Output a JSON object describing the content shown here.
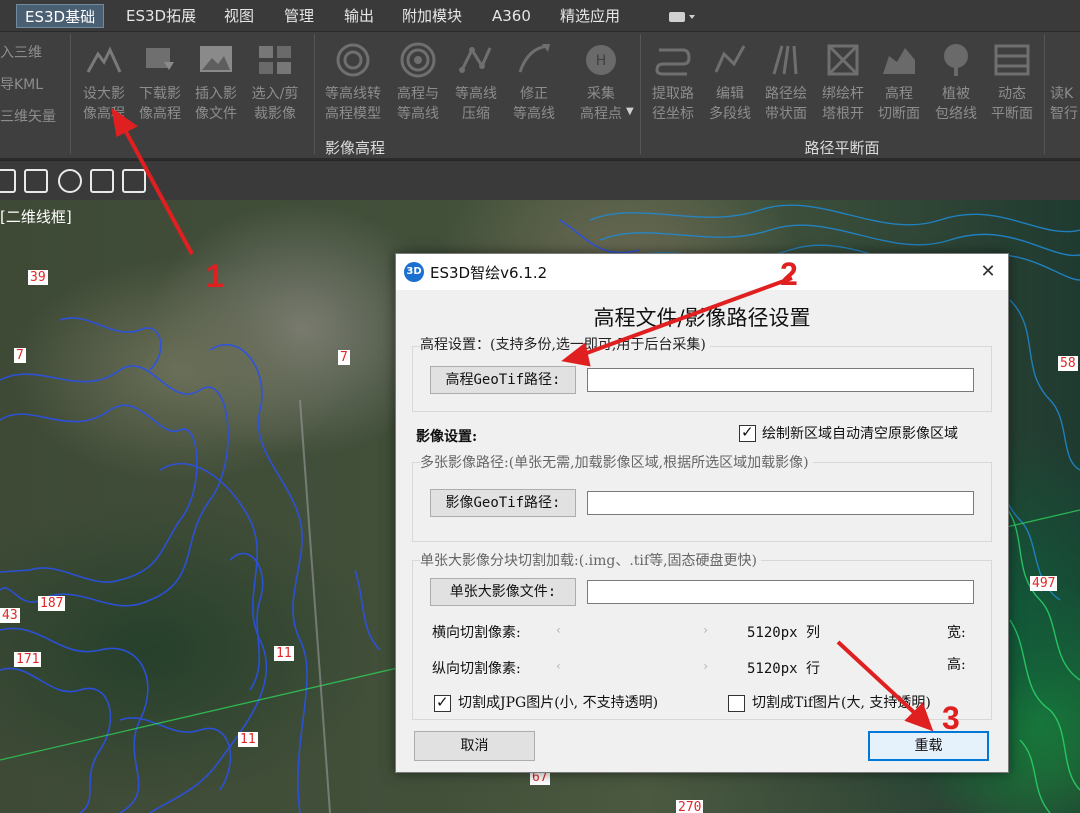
{
  "menubar": {
    "tabs": [
      {
        "label": "ES3D基础",
        "active": true
      },
      {
        "label": "ES3D拓展"
      },
      {
        "label": "视图"
      },
      {
        "label": "管理"
      },
      {
        "label": "输出"
      },
      {
        "label": "附加模块"
      },
      {
        "label": "A360"
      },
      {
        "label": "精选应用"
      }
    ]
  },
  "ribbon": {
    "left_items": [
      "入三维",
      "导KML",
      "三维矢量"
    ],
    "group1_buttons": [
      {
        "line1": "设大影",
        "line2": "像高程"
      },
      {
        "line1": "下载影",
        "line2": "像高程"
      },
      {
        "line1": "插入影",
        "line2": "像文件"
      },
      {
        "line1": "选入/剪",
        "line2": "裁影像"
      }
    ],
    "group2_buttons": [
      {
        "line1": "等高线转",
        "line2": "高程模型"
      },
      {
        "line1": "高程与",
        "line2": "等高线"
      },
      {
        "line1": "等高线",
        "line2": "压缩"
      },
      {
        "line1": "修正",
        "line2": "等高线"
      },
      {
        "line1": "采集",
        "line2": "高程点"
      }
    ],
    "group3_buttons": [
      {
        "line1": "提取路",
        "line2": "径坐标"
      },
      {
        "line1": "编辑",
        "line2": "多段线"
      },
      {
        "line1": "路径绘",
        "line2": "带状面"
      },
      {
        "line1": "绑绘杆",
        "line2": "塔根开"
      },
      {
        "line1": "高程",
        "line2": "切断面"
      },
      {
        "line1": "植被",
        "line2": "包络线"
      },
      {
        "line1": "动态",
        "line2": "平断面"
      }
    ],
    "right_cut": {
      "line1": "读K",
      "line2": "智行"
    },
    "panel_titles": {
      "imagery": "影像高程",
      "route": "路径平断面"
    }
  },
  "viewport": {
    "label": "[二维线框]",
    "elevation_labels": [
      "39",
      "7",
      "7",
      "58",
      "43",
      "187",
      "171",
      "11",
      "11",
      "497",
      "67",
      "270"
    ]
  },
  "dialog": {
    "title": "ES3D智绘v6.1.2",
    "heading": "高程文件/影像路径设置",
    "elev_section": "高程设置：(支持多份,选一即可,用于后台采集)",
    "elev_button": "高程GeoTif路径:",
    "elev_path": "",
    "image_section": "影像设置:",
    "auto_clear_label": "绘制新区域自动清空原影像区域",
    "auto_clear_checked": true,
    "multi_section": "多张影像路径:(单张无需,加载影像区域,根据所选区域加载影像)",
    "image_button": "影像GeoTif路径:",
    "image_path": "",
    "single_section": "单张大影像分块切割加载:(.img、.tif等,固态硬盘更快)",
    "single_button": "单张大影像文件:",
    "single_path": "",
    "h_split_label": "横向切割像素:",
    "h_split_value": "5120px 列",
    "width_label": "宽:",
    "v_split_label": "纵向切割像素:",
    "v_split_value": "5120px 行",
    "height_label": "高:",
    "jpg_label": "切割成JPG图片(小, 不支持透明)",
    "jpg_checked": true,
    "tif_label": "切割成Tif图片(大, 支持透明)",
    "tif_checked": false,
    "cancel_label": "取消",
    "reload_label": "重载"
  },
  "annotations": [
    "1",
    "2",
    "3"
  ],
  "colors": {
    "annotation": "#e02020",
    "accent": "#1a6fd1",
    "contour": "#2a52e8"
  }
}
